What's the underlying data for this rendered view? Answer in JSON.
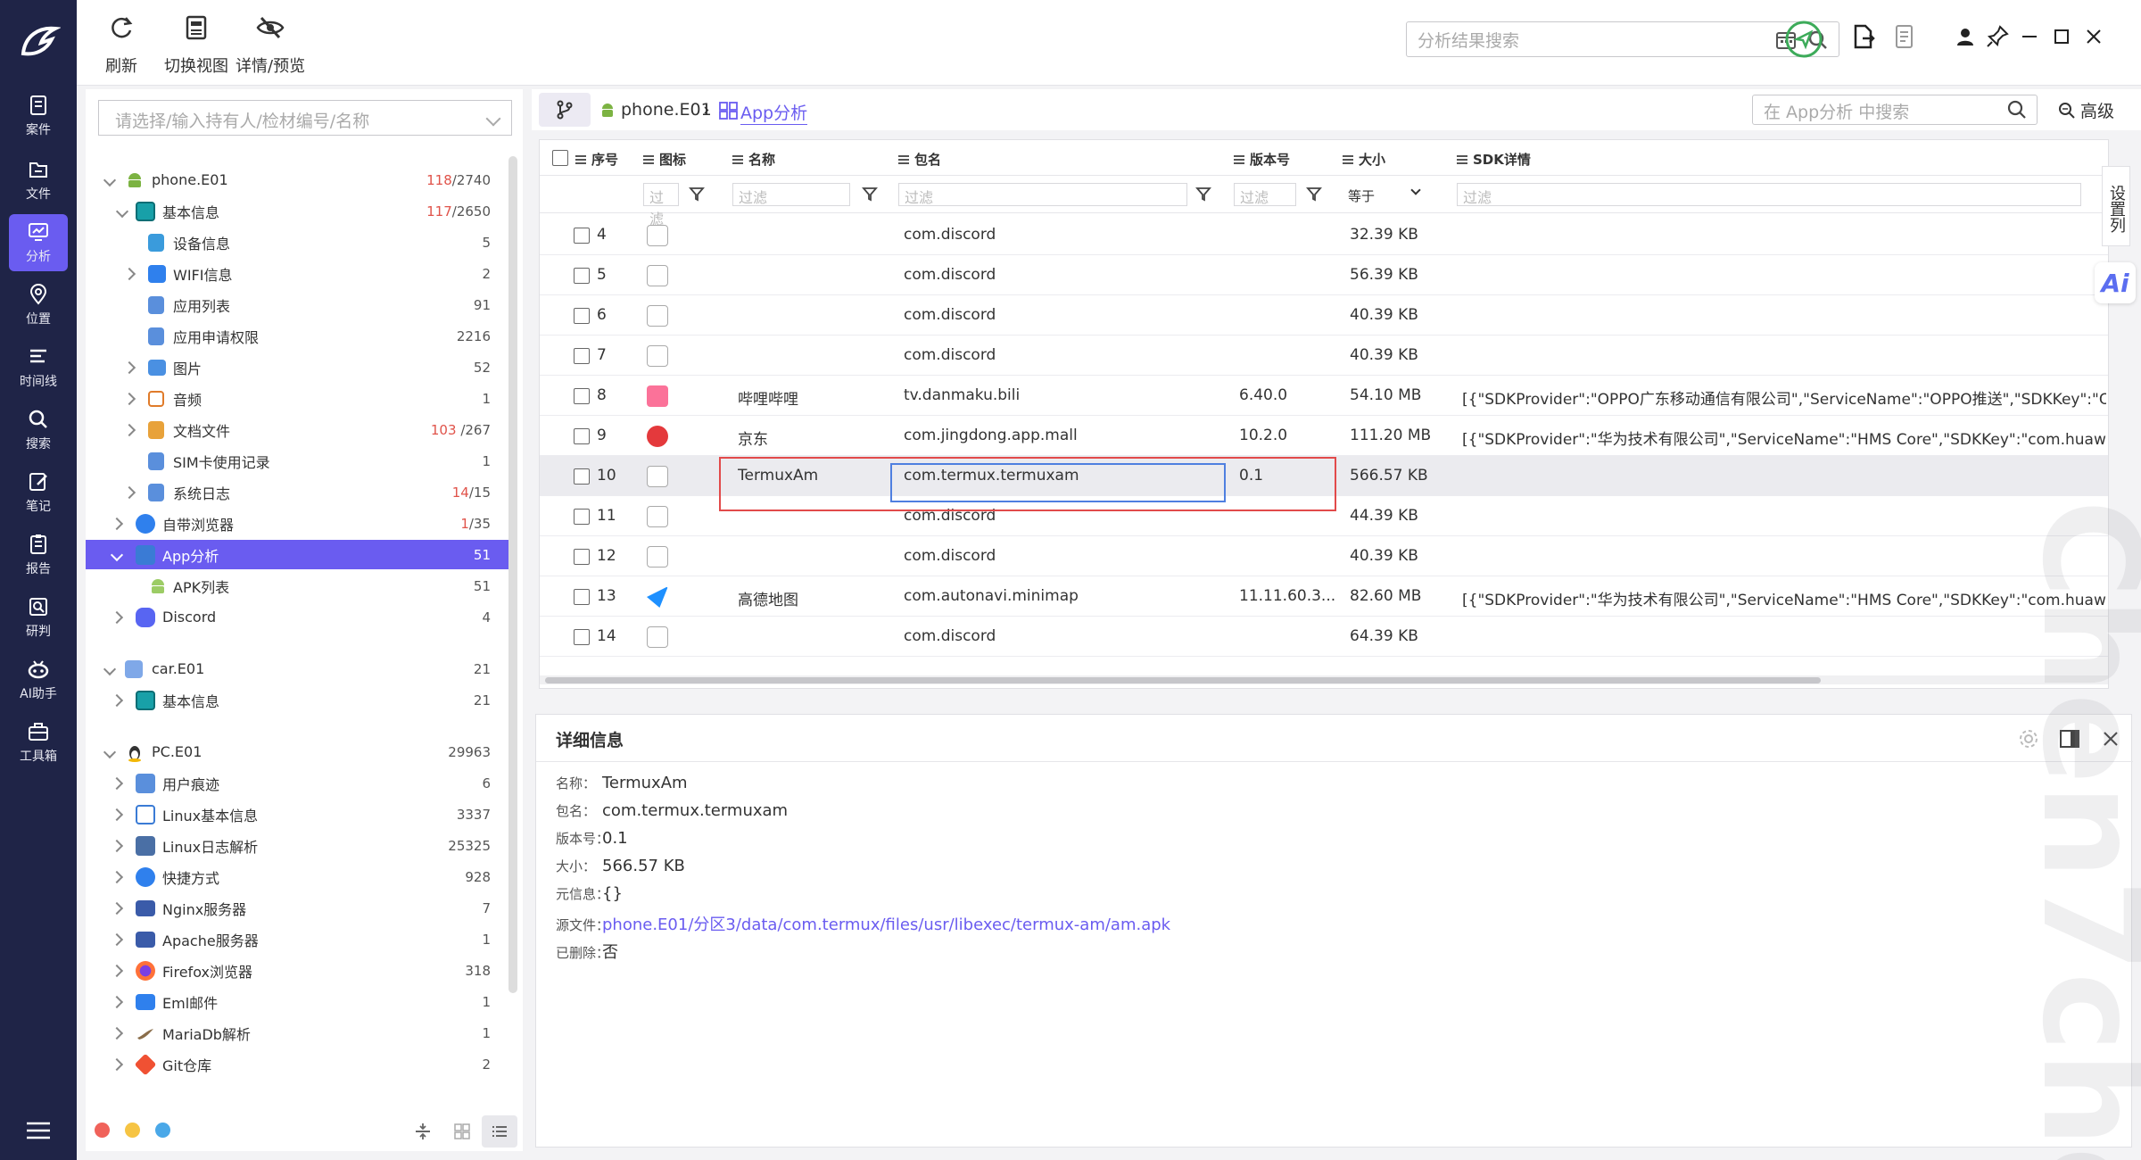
{
  "rail": {
    "items": [
      {
        "label": "案件",
        "icon": "case-icon"
      },
      {
        "label": "文件",
        "icon": "folder-icon"
      },
      {
        "label": "分析",
        "icon": "analysis-icon",
        "active": true
      },
      {
        "label": "位置",
        "icon": "location-icon"
      },
      {
        "label": "时间线",
        "icon": "timeline-icon"
      },
      {
        "label": "搜索",
        "icon": "search-icon"
      },
      {
        "label": "笔记",
        "icon": "note-icon"
      },
      {
        "label": "报告",
        "icon": "report-icon"
      },
      {
        "label": "研判",
        "icon": "judge-icon"
      },
      {
        "label": "AI助手",
        "icon": "ai-icon"
      },
      {
        "label": "工具箱",
        "icon": "toolbox-icon"
      }
    ]
  },
  "toolbar": {
    "refresh": "刷新",
    "switch_view": "切换视图",
    "detail_preview": "详情/预览",
    "search_placeholder": "分析结果搜索"
  },
  "tree": {
    "holder_placeholder": "请选择/输入持有人/检材编号/名称",
    "rows": [
      {
        "label": "phone.E01",
        "count_a": "118",
        "count_b": "/2740"
      },
      {
        "label": "基本信息",
        "count_a": "117",
        "count_b": "/2650"
      },
      {
        "label": "设备信息",
        "count_b": "5"
      },
      {
        "label": "WIFI信息",
        "count_b": "2"
      },
      {
        "label": "应用列表",
        "count_b": "91"
      },
      {
        "label": "应用申请权限",
        "count_b": "2216"
      },
      {
        "label": "图片",
        "count_b": "52"
      },
      {
        "label": "音频",
        "count_b": "1"
      },
      {
        "label": "文档文件",
        "count_a": "103",
        "count_b": "/267"
      },
      {
        "label": "SIM卡使用记录",
        "count_b": "1"
      },
      {
        "label": "系统日志",
        "count_a": "14",
        "count_b": "/15"
      },
      {
        "label": "自带浏览器",
        "count_a": "1",
        "count_b": "/35"
      },
      {
        "label": "App分析",
        "count_b": "51"
      },
      {
        "label": "APK列表",
        "count_b": "51"
      },
      {
        "label": "Discord",
        "count_b": "4"
      },
      {
        "label": "car.E01",
        "count_b": "21"
      },
      {
        "label": "基本信息",
        "count_b": "21"
      },
      {
        "label": "PC.E01",
        "count_b": "29963"
      },
      {
        "label": "用户痕迹",
        "count_b": "6"
      },
      {
        "label": "Linux基本信息",
        "count_b": "3337"
      },
      {
        "label": "Linux日志解析",
        "count_b": "25325"
      },
      {
        "label": "快捷方式",
        "count_b": "928"
      },
      {
        "label": "Nginx服务器",
        "count_b": "7"
      },
      {
        "label": "Apache服务器",
        "count_b": "1"
      },
      {
        "label": "Firefox浏览器",
        "count_b": "318"
      },
      {
        "label": "Eml邮件",
        "count_b": "1"
      },
      {
        "label": "MariaDb解析",
        "count_b": "1"
      },
      {
        "label": "Git仓库",
        "count_b": "2"
      }
    ]
  },
  "breadcrumb": {
    "device": "phone.E01",
    "sep": "›",
    "current": "App分析",
    "search_placeholder": "在 App分析 中搜索",
    "advanced": "高级"
  },
  "grid": {
    "headers": [
      "序号",
      "图标",
      "名称",
      "包名",
      "版本号",
      "大小",
      "SDK详情"
    ],
    "filter_placeholder": "过滤",
    "size_filter": "等于",
    "rows": [
      {
        "no": "4",
        "name": "",
        "pkg": "com.discord",
        "ver": "",
        "size": "32.39 KB",
        "sdk": ""
      },
      {
        "no": "5",
        "name": "",
        "pkg": "com.discord",
        "ver": "",
        "size": "56.39 KB",
        "sdk": ""
      },
      {
        "no": "6",
        "name": "",
        "pkg": "com.discord",
        "ver": "",
        "size": "40.39 KB",
        "sdk": ""
      },
      {
        "no": "7",
        "name": "",
        "pkg": "com.discord",
        "ver": "",
        "size": "40.39 KB",
        "sdk": ""
      },
      {
        "no": "8",
        "name": "哔哩哔哩",
        "pkg": "tv.danmaku.bili",
        "ver": "6.40.0",
        "size": "54.10 MB",
        "sdk": "[{\"SDKProvider\":\"OPPO广东移动通信有限公司\",\"ServiceName\":\"OPPO推送\",\"SDKKey\":\"OPPO_A"
      },
      {
        "no": "9",
        "name": "京东",
        "pkg": "com.jingdong.app.mall",
        "ver": "10.2.0",
        "size": "111.20 MB",
        "sdk": "[{\"SDKProvider\":\"华为技术有限公司\",\"ServiceName\":\"HMS Core\",\"SDKKey\":\"com.huawei.hms.c"
      },
      {
        "no": "10",
        "name": "TermuxAm",
        "pkg": "com.termux.termuxam",
        "ver": "0.1",
        "size": "566.57 KB",
        "sdk": ""
      },
      {
        "no": "11",
        "name": "",
        "pkg": "com.discord",
        "ver": "",
        "size": "44.39 KB",
        "sdk": ""
      },
      {
        "no": "12",
        "name": "",
        "pkg": "com.discord",
        "ver": "",
        "size": "40.39 KB",
        "sdk": ""
      },
      {
        "no": "13",
        "name": "高德地图",
        "pkg": "com.autonavi.minimap",
        "ver": "11.11.60.3...",
        "size": "82.60 MB",
        "sdk": "[{\"SDKProvider\":\"华为技术有限公司\",\"ServiceName\":\"HMS Core\",\"SDKKey\":\"com.huawei.hms.c"
      },
      {
        "no": "14",
        "name": "",
        "pkg": "com.discord",
        "ver": "",
        "size": "64.39 KB",
        "sdk": ""
      }
    ],
    "side_tab": "设置列",
    "ai_badge": "Ai"
  },
  "detail": {
    "title": "详细信息",
    "fields": [
      {
        "k": "名称：",
        "v": "TermuxAm"
      },
      {
        "k": "包名：",
        "v": "com.termux.termuxam"
      },
      {
        "k": "版本号：",
        "v": "0.1"
      },
      {
        "k": "大小：",
        "v": "566.57 KB"
      },
      {
        "k": "元信息：",
        "v": "{}"
      },
      {
        "k": "源文件：",
        "v": "phone.E01/分区3/data/com.termux/files/usr/libexec/termux-am/am.apk",
        "link": true
      },
      {
        "k": "已删除：",
        "v": "否"
      }
    ]
  },
  "watermark": "Chen7chen",
  "colors": {
    "accent": "#6a5cf0",
    "rail": "#1f2447",
    "highlight_border": "#e24a4a",
    "selected_cell": "#4f7fe0"
  }
}
